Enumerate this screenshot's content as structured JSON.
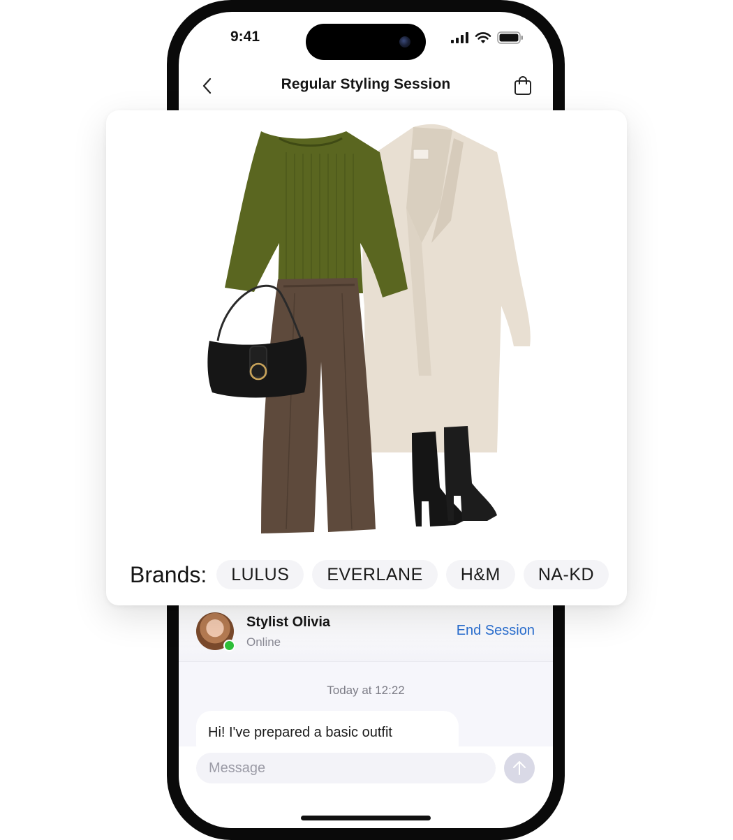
{
  "status_bar": {
    "time": "9:41"
  },
  "nav": {
    "title": "Regular Styling Session"
  },
  "outfit": {
    "brands_label": "Brands:",
    "brands": [
      "LULUS",
      "EVERLANE",
      "H&M",
      "NA-KD"
    ]
  },
  "chat": {
    "stylist_name": "Stylist Olivia",
    "stylist_status": "Online",
    "end_session_label": "End Session",
    "timestamp": "Today at 12:22",
    "first_message": "Hi! I've prepared a basic outfit"
  },
  "composer": {
    "placeholder": "Message"
  },
  "colors": {
    "accent_link": "#2a6fd1",
    "online": "#2fbf3a",
    "sweater": "#5a6620",
    "pants": "#5e4a3c",
    "coat": "#e6ddd0"
  }
}
